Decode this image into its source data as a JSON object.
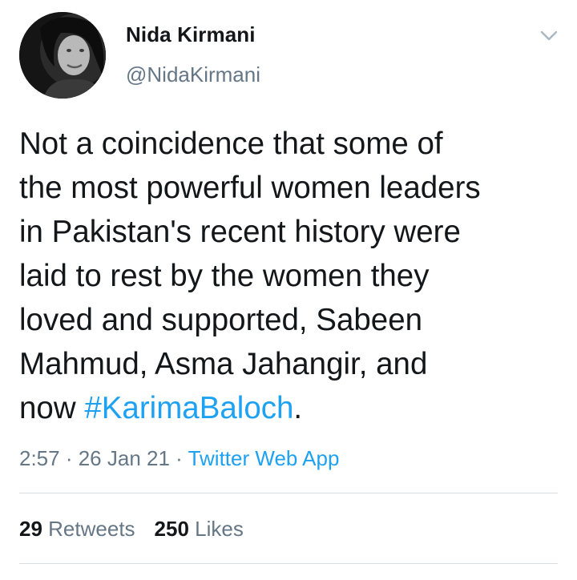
{
  "author": {
    "display_name": "Nida Kirmani",
    "handle": "@NidaKirmani"
  },
  "tweet": {
    "text_lines": [
      "Not a coincidence that some of",
      "the most powerful women leaders",
      "in Pakistan's recent history were",
      "laid to rest by the women they",
      "loved and supported, Sabeen",
      "Mahmud, Asma Jahangir, and"
    ],
    "last_line_prefix": "now ",
    "hashtag": "#KarimaBaloch",
    "last_line_suffix": "."
  },
  "meta": {
    "time": "2:57",
    "separator": " · ",
    "date": "26 Jan 21",
    "source": "Twitter Web App"
  },
  "stats": {
    "retweets_count": "29",
    "retweets_label": "Retweets",
    "likes_count": "250",
    "likes_label": "Likes"
  },
  "colors": {
    "link": "#1da1f2",
    "secondary_text": "#657786",
    "primary_text": "#14171a",
    "divider": "#d8dde1"
  },
  "icons": {
    "chevron": "chevron-down-icon",
    "avatar": "avatar"
  }
}
